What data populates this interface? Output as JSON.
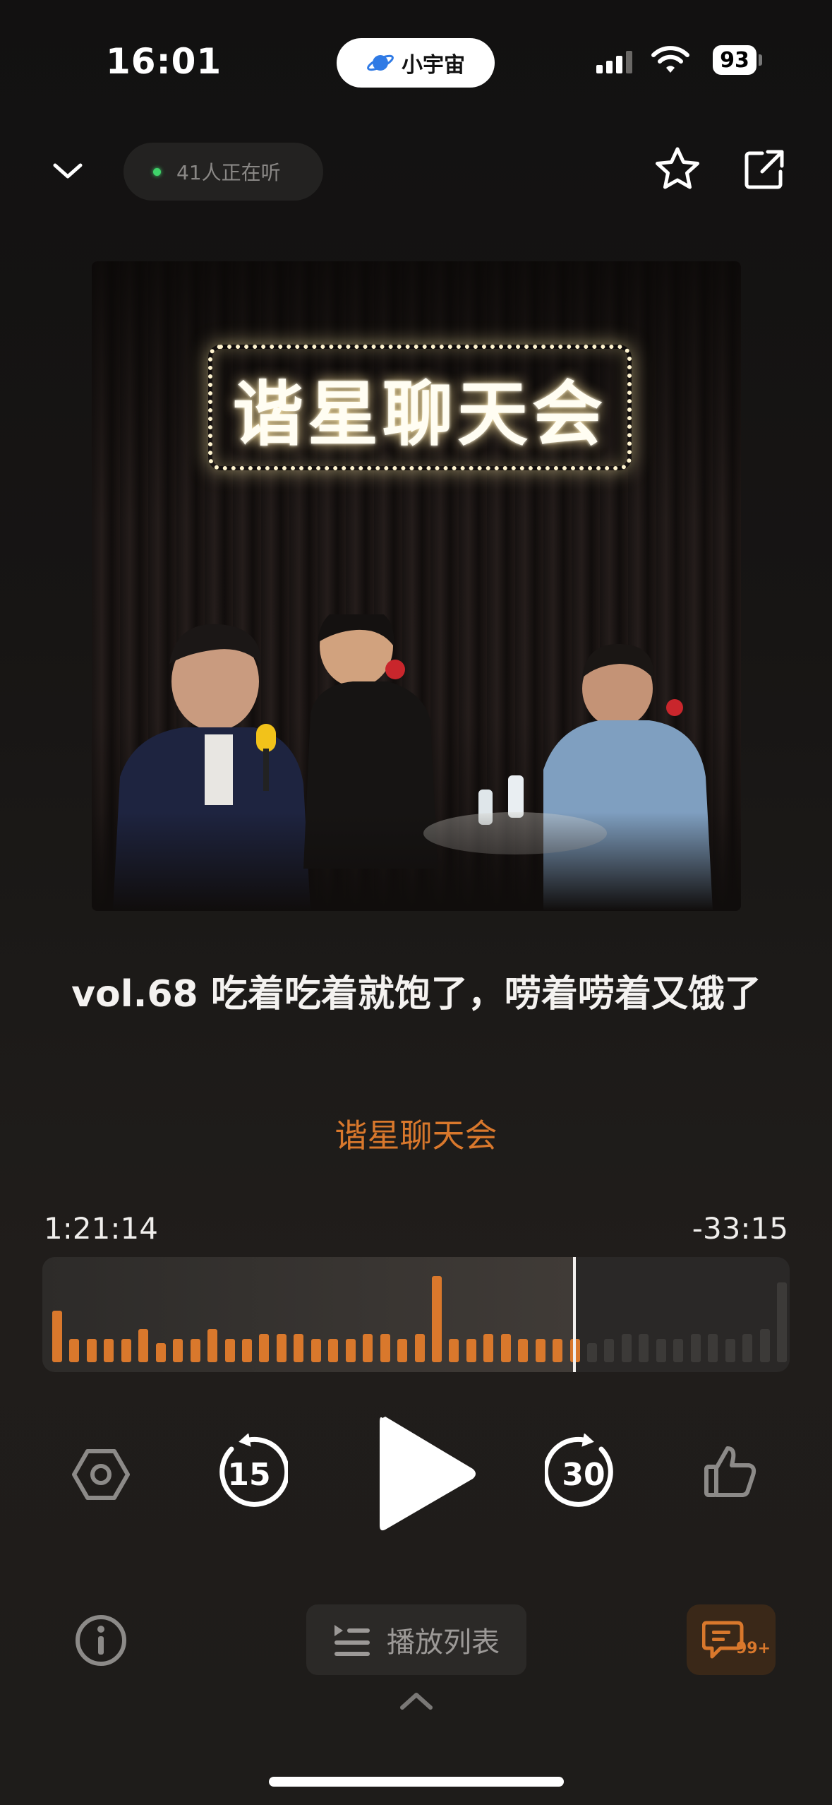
{
  "status_bar": {
    "time": "16:01",
    "app_pill_label": "小宇宙",
    "battery": "93"
  },
  "top_bar": {
    "listeners": "41人正在听"
  },
  "cover": {
    "sign_text": "谐星聊天会"
  },
  "episode": {
    "title": "vol.68 吃着吃着就饱了，唠着唠着又饿了",
    "podcast": "谐星聊天会"
  },
  "player": {
    "elapsed": "1:21:14",
    "remaining": "-33:15",
    "progress": 0.71,
    "skip_back_seconds": "15",
    "skip_forward_seconds": "30"
  },
  "bottom_bar": {
    "playlist_label": "播放列表",
    "comments_badge": "99+"
  },
  "colors": {
    "accent": "#d9782c",
    "background": "#161514",
    "live_dot": "#3fd36a"
  },
  "waveform": {
    "levels": [
      0.55,
      0.25,
      0.25,
      0.25,
      0.25,
      0.35,
      0.2,
      0.25,
      0.25,
      0.35,
      0.25,
      0.25,
      0.3,
      0.3,
      0.3,
      0.25,
      0.25,
      0.25,
      0.3,
      0.3,
      0.25,
      0.3,
      0.92,
      0.25,
      0.25,
      0.3,
      0.3,
      0.25,
      0.25,
      0.25,
      0.25,
      0.2,
      0.25,
      0.3,
      0.3,
      0.25,
      0.25,
      0.3,
      0.3,
      0.25,
      0.3,
      0.35,
      0.85
    ]
  }
}
